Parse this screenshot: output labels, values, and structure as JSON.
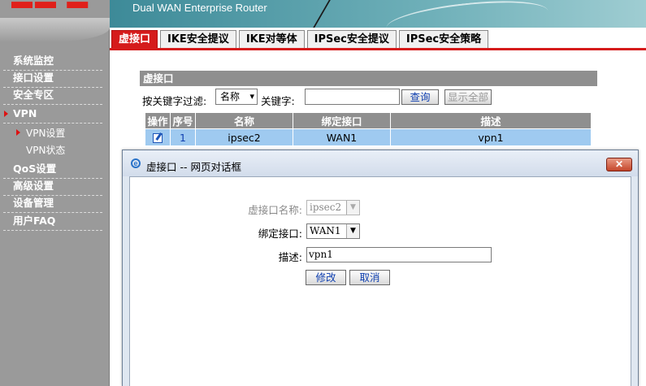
{
  "app": {
    "header_title": "Dual WAN Enterprise Router"
  },
  "sidebar": {
    "items": [
      {
        "label": "系统监控"
      },
      {
        "label": "接口设置"
      },
      {
        "label": "安全专区"
      },
      {
        "label": "VPN"
      },
      {
        "label": "QoS设置"
      },
      {
        "label": "高级设置"
      },
      {
        "label": "设备管理"
      },
      {
        "label": "用户FAQ"
      }
    ],
    "vpn_sub": [
      {
        "label": "VPN设置"
      },
      {
        "label": "VPN状态"
      }
    ],
    "active": "VPN",
    "active_sub": "VPN设置",
    "accent_color": "#d51b1b"
  },
  "tabs": [
    {
      "label": "虚接口",
      "active": true
    },
    {
      "label": "IKE安全提议"
    },
    {
      "label": "IKE对等体"
    },
    {
      "label": "IPSec安全提议"
    },
    {
      "label": "IPSec安全策略"
    }
  ],
  "section": {
    "title": "虚接口",
    "filter_label": "按关键字过滤:",
    "filter_value": "名称",
    "keyword_label": "关键字:",
    "keyword_value": "",
    "query_button": "查询",
    "show_all_button": "显示全部"
  },
  "table": {
    "columns": [
      "操作",
      "序号",
      "名称",
      "绑定接口",
      "描述"
    ],
    "rows": [
      {
        "op_icon": "edit-icon",
        "index": "1",
        "name": "ipsec2",
        "bind": "WAN1",
        "desc": "vpn1"
      }
    ]
  },
  "dialog": {
    "title": "虚接口 -- 网页对话框",
    "close_icon": "close-x-icon",
    "fields": {
      "name_label": "虚接口名称:",
      "name_value": "ipsec2",
      "bind_label": "绑定接口:",
      "bind_value": "WAN1",
      "desc_label": "描述:",
      "desc_value": "vpn1"
    },
    "modify_button": "修改",
    "cancel_button": "取消"
  }
}
